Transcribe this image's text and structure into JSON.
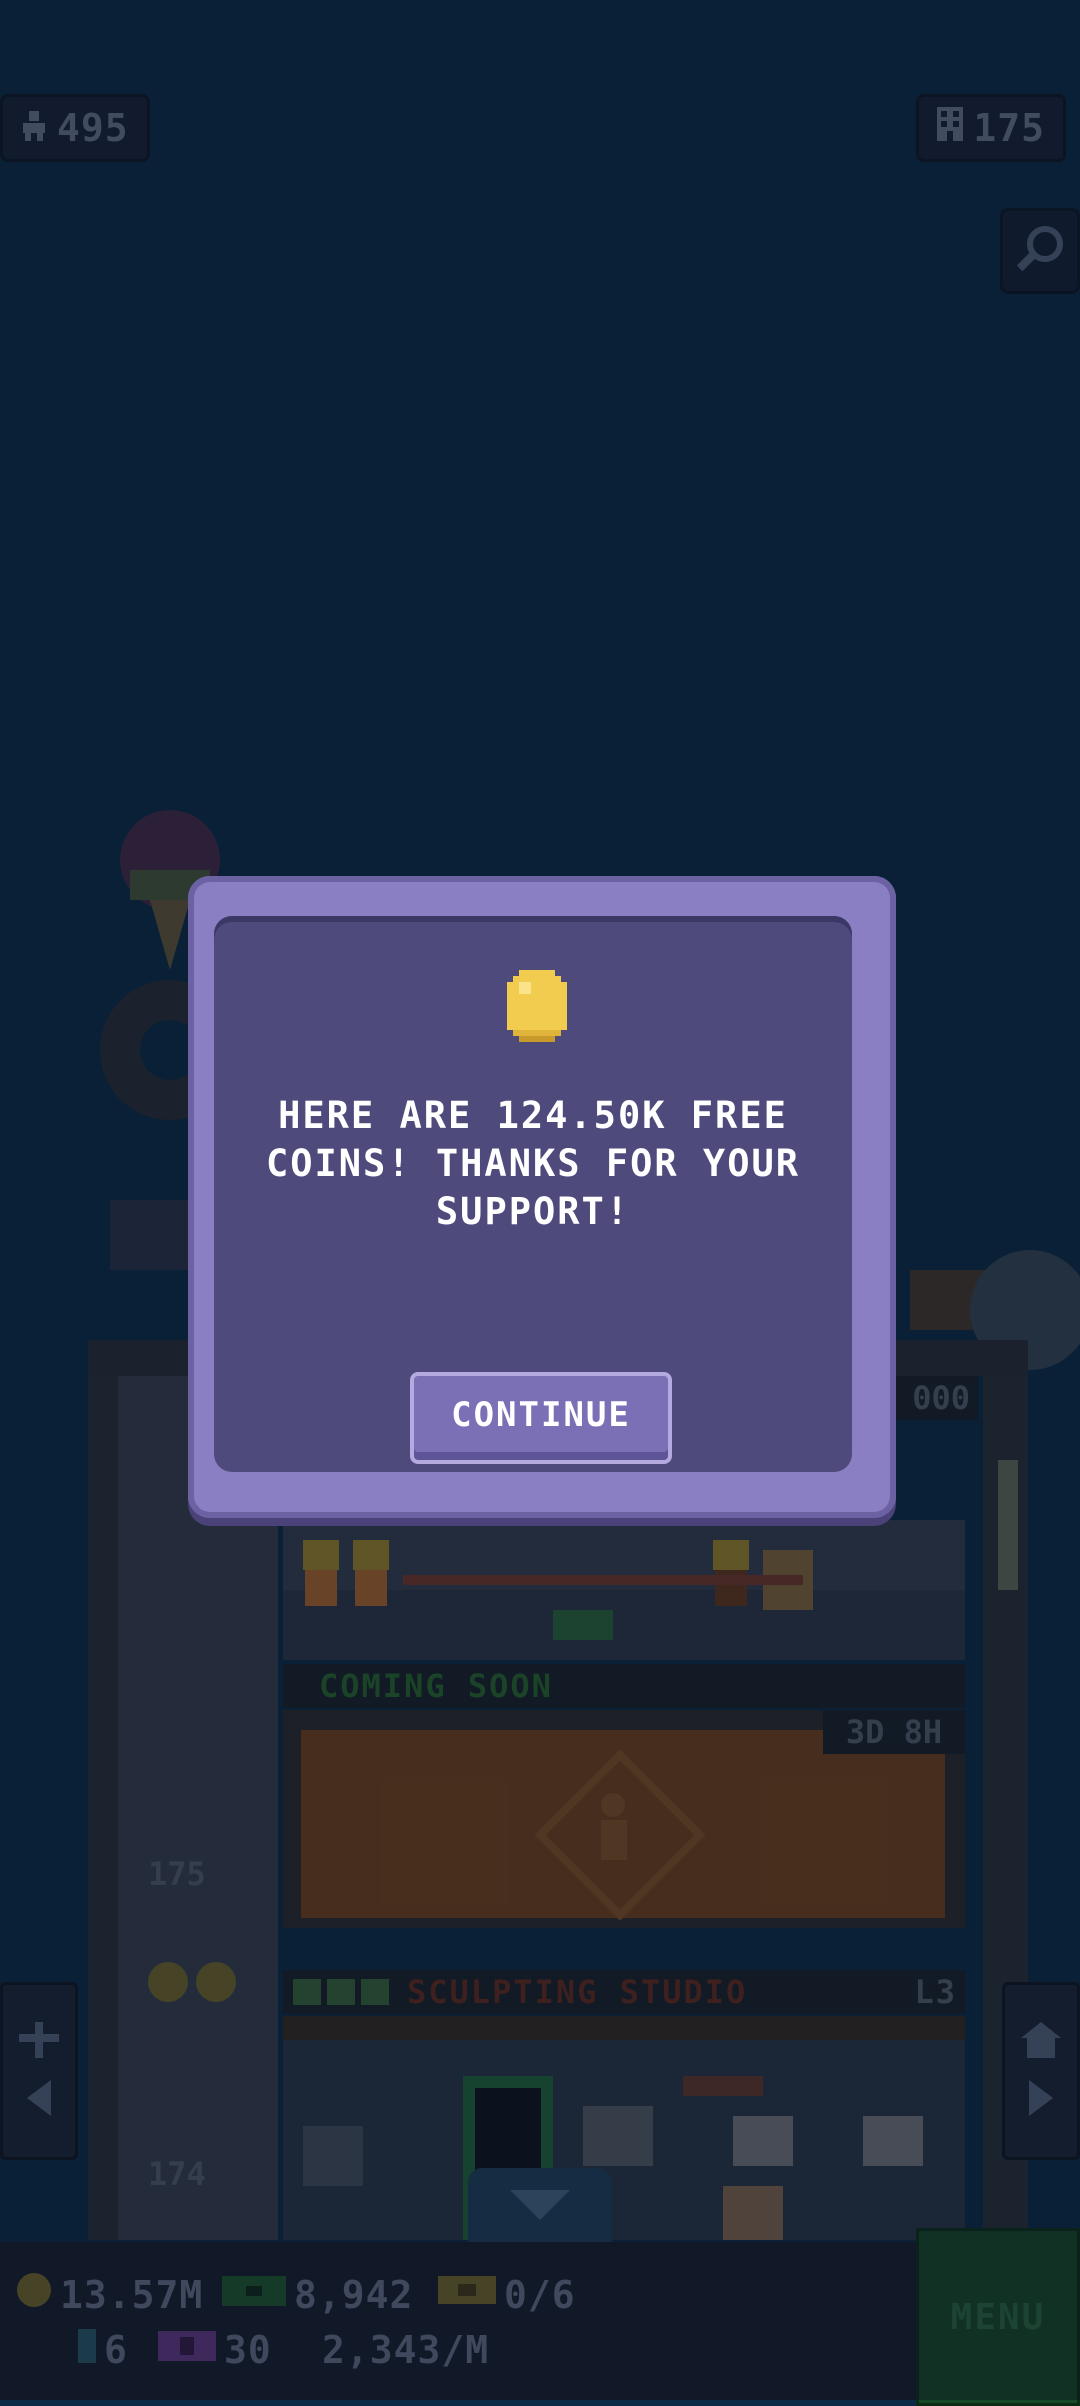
{
  "top": {
    "population": "495",
    "floors": "175"
  },
  "tower": {
    "coming_soon": "COMING SOON",
    "timer": "3D 8H",
    "floor_175": "175",
    "floor_174": "174",
    "studio_name": "SCULPTING STUDIO",
    "studio_level": "L3",
    "top_counter": "000"
  },
  "bottom": {
    "coins": "13.57M",
    "bux": "8,942",
    "tickets": "0/6",
    "keys": "6",
    "vip": "30",
    "rate": "2,343/M",
    "menu": "MENU"
  },
  "dialog": {
    "message": "HERE ARE 124.50K FREE COINS! THANKS FOR YOUR SUPPORT!",
    "button": "CONTINUE"
  },
  "colors": {
    "sky": "#0a2b46",
    "dialog_outer": "#8a7fc2",
    "dialog_inner": "#4e4a7c",
    "coin": "#f2cc4e",
    "menu": "#164a26"
  }
}
